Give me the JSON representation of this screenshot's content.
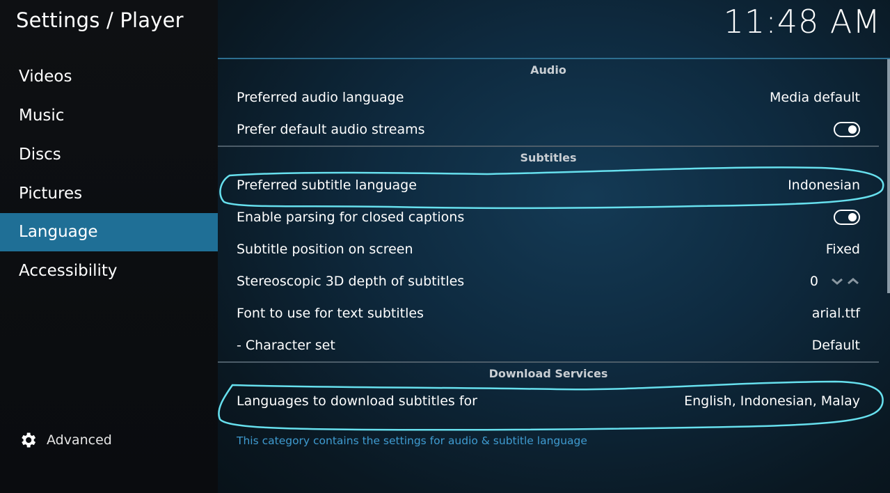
{
  "header": {
    "title": "Settings / Player",
    "clock": "11:48 AM"
  },
  "sidebar": {
    "items": [
      {
        "label": "Videos"
      },
      {
        "label": "Music"
      },
      {
        "label": "Discs"
      },
      {
        "label": "Pictures"
      },
      {
        "label": "Language",
        "active": true
      },
      {
        "label": "Accessibility"
      }
    ],
    "advanced_label": "Advanced"
  },
  "sections": {
    "audio": {
      "header": "Audio",
      "preferred_audio_label": "Preferred audio language",
      "preferred_audio_value": "Media default",
      "prefer_default_streams_label": "Prefer default audio streams",
      "prefer_default_streams_on": true
    },
    "subtitles": {
      "header": "Subtitles",
      "preferred_subtitle_label": "Preferred subtitle language",
      "preferred_subtitle_value": "Indonesian",
      "closed_captions_label": "Enable parsing for closed captions",
      "closed_captions_on": true,
      "position_label": "Subtitle position on screen",
      "position_value": "Fixed",
      "stereo_depth_label": "Stereoscopic 3D depth of subtitles",
      "stereo_depth_value": "0",
      "font_label": "Font to use for text subtitles",
      "font_value": "arial.ttf",
      "charset_label": "- Character set",
      "charset_value": "Default"
    },
    "download": {
      "header": "Download Services",
      "languages_label": "Languages to download subtitles for",
      "languages_value": "English, Indonesian, Malay"
    }
  },
  "footer": {
    "description": "This category contains the settings for audio & subtitle language"
  },
  "colors": {
    "active_item": "#1f6f96",
    "annotation": "#67e0ee",
    "footer_text": "#3f9bd0"
  },
  "icons": {
    "advanced": "gear-icon",
    "spin_down": "chevron-down-icon",
    "spin_up": "chevron-up-icon"
  }
}
